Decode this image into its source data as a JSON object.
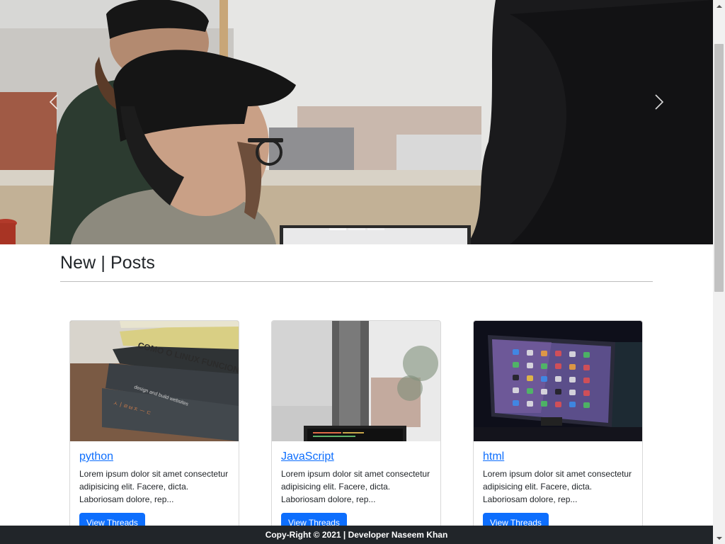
{
  "carousel": {
    "prev_label": "Previous",
    "next_label": "Next",
    "indicator_count": 3,
    "active_indicator": 1
  },
  "section": {
    "title": "New | Posts"
  },
  "cards": [
    {
      "title": "python",
      "text": "Lorem ipsum dolor sit amet consectetur adipisicing elit. Facere, dicta. Laboriosam dolore, rep...",
      "button_label": "View Threads",
      "image": "books-stack-image"
    },
    {
      "title": "JavaScript",
      "text": "Lorem ipsum dolor sit amet consectetur adipisicing elit. Facere, dicta. Laboriosam dolore, rep...",
      "button_label": "View Threads",
      "image": "window-laptop-image"
    },
    {
      "title": "html",
      "text": "Lorem ipsum dolor sit amet consectetur adipisicing elit. Facere, dicta. Laboriosam dolore, rep...",
      "button_label": "View Threads",
      "image": "monitor-apps-image"
    }
  ],
  "footer": {
    "text": "Copy-Right © 2021 | Developer Naseem Khan"
  },
  "colors": {
    "primary": "#0d6efd",
    "footer_bg": "#212529",
    "text": "#212529"
  }
}
